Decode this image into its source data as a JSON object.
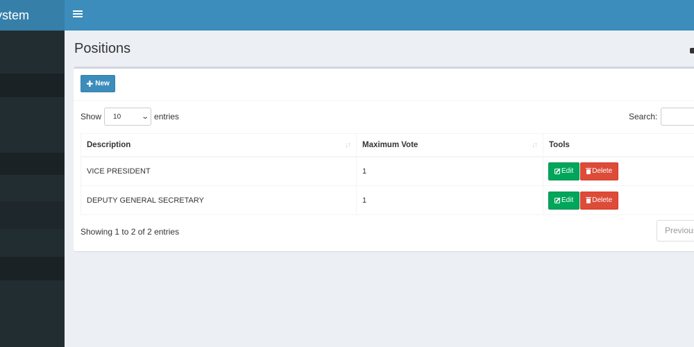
{
  "app": {
    "logo_text": "ystem"
  },
  "navbar": {
    "toggle_icon": "hamburger-icon"
  },
  "page": {
    "title": "Positions"
  },
  "toolbar": {
    "new_label": "New",
    "new_icon": "plus-icon"
  },
  "table_controls": {
    "show_label": "Show",
    "entries_label": "entries",
    "page_length": "10",
    "search_label": "Search:"
  },
  "table": {
    "headers": [
      "Description",
      "Maximum Vote",
      "Tools"
    ],
    "rows": [
      {
        "description": "VICE PRESIDENT",
        "max_vote": "1",
        "edit": "Edit",
        "delete": "Delete"
      },
      {
        "description": "DEPUTY GENERAL SECRETARY",
        "max_vote": "1",
        "edit": "Edit",
        "delete": "Delete"
      }
    ]
  },
  "footer": {
    "info": "Showing 1 to 2 of 2 entries",
    "previous": "Previous"
  },
  "colors": {
    "navbar": "#3c8dbc",
    "logo_bg": "#367fa9",
    "sidebar": "#222d32",
    "edit": "#00a65a",
    "delete": "#dd4b39",
    "background": "#ecf0f5"
  }
}
